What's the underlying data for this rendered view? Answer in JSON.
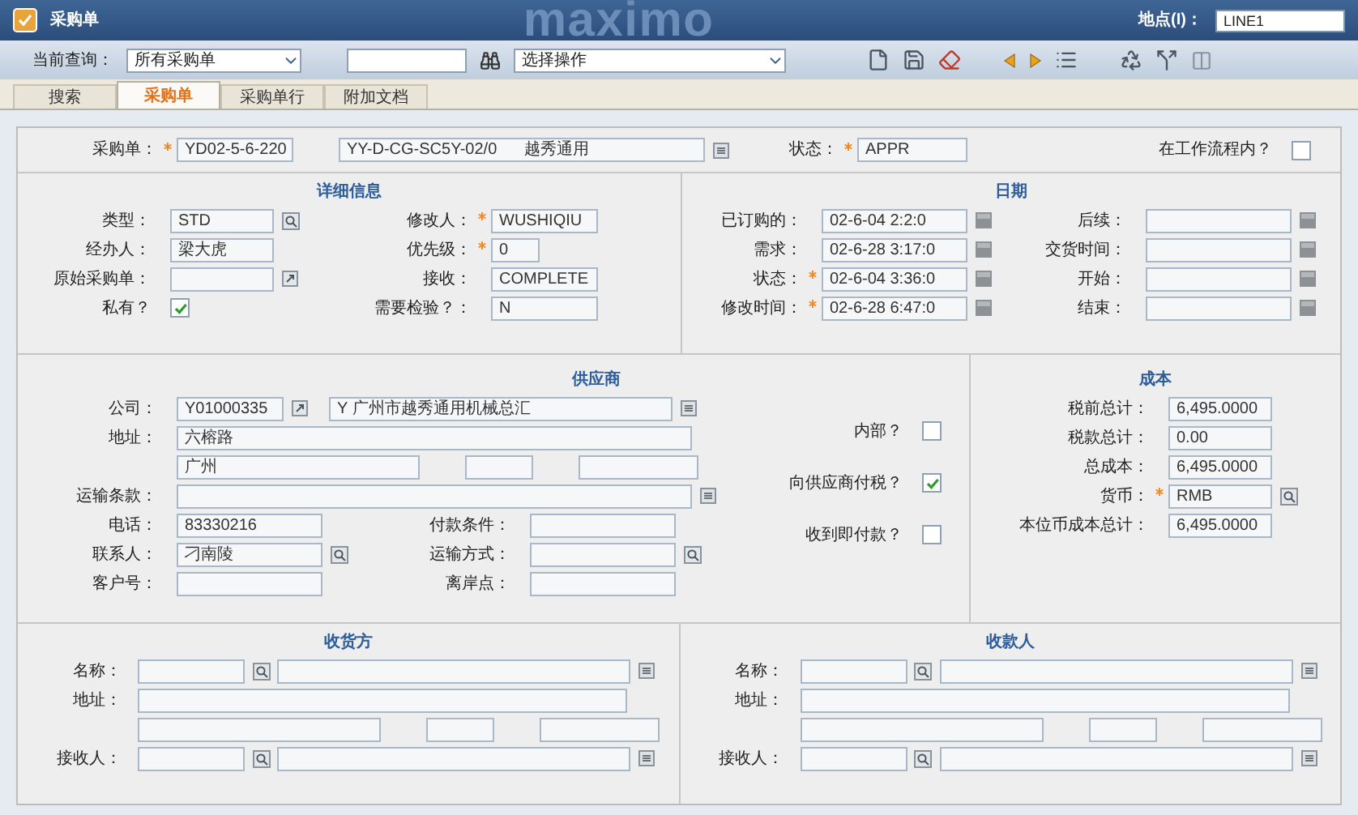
{
  "window": {
    "title": "采购单",
    "logo": "maximo",
    "site_label": "地点(I)：",
    "site_value": "LINE1"
  },
  "toolbar": {
    "query_label": "当前查询：",
    "query_value": "所有采购单",
    "action_value": "选择操作"
  },
  "tabs": [
    {
      "label": "搜索",
      "selected": false
    },
    {
      "label": "采购单",
      "selected": true
    },
    {
      "label": "采购单行",
      "selected": false
    },
    {
      "label": "附加文档",
      "selected": false
    }
  ],
  "header": {
    "po": {
      "kind": "text",
      "label": "采购单：",
      "required": true,
      "value": "YD02-5-6-220"
    },
    "description": {
      "kind": "text",
      "value": "YY-D-CG-SC5Y-02/0      越秀通用",
      "button": {
        "kind": "menu"
      }
    },
    "status": {
      "kind": "text",
      "label": "状态：",
      "required": true,
      "value": "APPR"
    },
    "workflow": {
      "kind": "check",
      "label": "在工作流程内？",
      "checked": false
    }
  },
  "details": {
    "title": "详细信息",
    "left": [
      {
        "kind": "text",
        "label": "类型：",
        "value": "STD",
        "button": {
          "kind": "lookup"
        }
      },
      {
        "kind": "text",
        "label": "经办人：",
        "value": "梁大虎"
      },
      {
        "kind": "text",
        "label": "原始采购单：",
        "button": {
          "kind": "goto"
        }
      },
      {
        "kind": "check",
        "label": "私有？",
        "checked": true
      }
    ],
    "right": [
      {
        "kind": "text",
        "label": "修改人：",
        "required": true,
        "value": "WUSHIQIU"
      },
      {
        "kind": "text",
        "label": "优先级：",
        "required": true,
        "value": "0"
      },
      {
        "kind": "text",
        "label": "接收：",
        "value": "COMPLETE"
      },
      {
        "kind": "text",
        "label": "需要检验？：",
        "value": "N"
      }
    ]
  },
  "dates": {
    "title": "日期",
    "left": [
      {
        "kind": "text",
        "label": "已订购的：",
        "value": "02-6-04 2:2:0",
        "button": {
          "kind": "date"
        }
      },
      {
        "kind": "text",
        "label": "需求：",
        "value": "02-6-28 3:17:0",
        "button": {
          "kind": "date"
        }
      },
      {
        "kind": "text",
        "label": "状态：",
        "required": true,
        "value": "02-6-04 3:36:0",
        "button": {
          "kind": "date"
        }
      },
      {
        "kind": "text",
        "label": "修改时间：",
        "required": true,
        "value": "02-6-28 6:47:0",
        "button": {
          "kind": "date"
        }
      }
    ],
    "right": [
      {
        "kind": "text",
        "label": "后续：",
        "button": {
          "kind": "date"
        }
      },
      {
        "kind": "text",
        "label": "交货时间：",
        "button": {
          "kind": "date"
        }
      },
      {
        "kind": "text",
        "label": "开始：",
        "button": {
          "kind": "date"
        }
      },
      {
        "kind": "text",
        "label": "结束：",
        "button": {
          "kind": "date"
        }
      }
    ]
  },
  "vendor": {
    "title": "供应商",
    "company": {
      "kind": "text",
      "label": "公司：",
      "value": "Y01000335",
      "button": {
        "kind": "goto"
      }
    },
    "company_name": {
      "kind": "text",
      "value": "Y 广州市越秀通用机械总汇",
      "button": {
        "kind": "menu"
      }
    },
    "address": {
      "kind": "text",
      "label": "地址：",
      "value": "六榕路"
    },
    "city": "广州",
    "terms": {
      "kind": "text",
      "label": "运输条款：",
      "button": {
        "kind": "menu"
      }
    },
    "left": [
      {
        "kind": "text",
        "label": "电话：",
        "value": "83330216"
      },
      {
        "kind": "text",
        "label": "联系人：",
        "value": "刁南陵",
        "button": {
          "kind": "lookup"
        }
      },
      {
        "kind": "text",
        "label": "客户号："
      }
    ],
    "right": [
      {
        "kind": "text",
        "label": "付款条件："
      },
      {
        "kind": "text",
        "label": "运输方式：",
        "button": {
          "kind": "lookup"
        }
      },
      {
        "kind": "text",
        "label": "离岸点："
      }
    ],
    "checks": [
      {
        "kind": "check",
        "label": "内部？",
        "checked": false
      },
      {
        "kind": "check",
        "label": "向供应商付税？",
        "checked": true
      },
      {
        "kind": "check",
        "label": "收到即付款？",
        "checked": false
      }
    ]
  },
  "cost": {
    "title": "成本",
    "fields": [
      {
        "kind": "text",
        "label": "税前总计：",
        "value": "6,495.0000"
      },
      {
        "kind": "text",
        "label": "税款总计：",
        "value": "0.00"
      },
      {
        "kind": "text",
        "label": "总成本：",
        "value": "6,495.0000"
      },
      {
        "kind": "text",
        "label": "货币：",
        "required": true,
        "value": "RMB",
        "button": {
          "kind": "lookup"
        }
      },
      {
        "kind": "text",
        "label": "本位币成本总计：",
        "value": "6,495.0000"
      }
    ]
  },
  "parties": [
    {
      "title": "收货方",
      "name_label": "名称：",
      "address_label": "地址：",
      "receiver_label": "接收人："
    },
    {
      "title": "收款人",
      "name_label": "名称：",
      "address_label": "地址：",
      "receiver_label": "接收人："
    }
  ]
}
